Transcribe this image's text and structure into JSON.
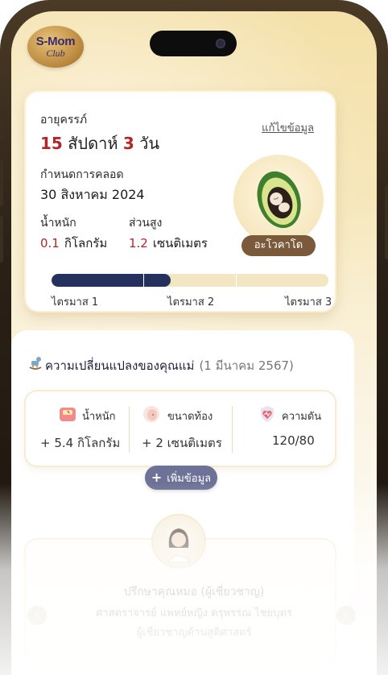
{
  "logo": {
    "line1": "S-Mom",
    "line2": "Club"
  },
  "pregnancy": {
    "age_label": "อายุครรภ์",
    "edit_link": "แก้ไขข้อมูล",
    "weeks": "15",
    "weeks_unit": "สัปดาห์",
    "days": "3",
    "days_unit": "วัน",
    "due_label": "กำหนดการคลอด",
    "due_date": "30 สิงหาคม 2024",
    "weight_label": "น้ำหนัก",
    "weight_value": "0.1",
    "weight_unit": "กิโลกรัม",
    "height_label": "ส่วนสูง",
    "height_value": "1.2",
    "height_unit": "เซนติเมตร",
    "fruit_name": "อะโวคาโด",
    "trimester_progress": 0.43,
    "trimesters": [
      "ไตรมาส 1",
      "ไตรมาส 2",
      "ไตรมาส 3"
    ]
  },
  "changes": {
    "title": "ความเปลี่ยนแปลงของคุณแม่",
    "date": "(1 มีนาคม 2567)",
    "stats": [
      {
        "icon": "scale-icon",
        "label": "น้ำหนัก",
        "value": "+ 5.4 กิโลกรัม"
      },
      {
        "icon": "belly-icon",
        "label": "ขนาดท้อง",
        "value": "+ 2 เซนติเมตร"
      },
      {
        "icon": "heart-shield-icon",
        "label": "ความดัน",
        "value": "120/80"
      }
    ],
    "add_button": "เพิ่มข้อมูล"
  },
  "doctor": {
    "role": "ปรึกษาคุณหมอ (ผู้เชี่ยวชาญ)",
    "name": "ศาสตราจารย์ แพทย์หญิง ดรุพรรณ ไชยบุตร",
    "extra": "ผู้เชี่ยวชาญด้านสูติศาสตร์"
  },
  "colors": {
    "accent_red": "#b2262a",
    "progress": "#24305e",
    "fruit_tag": "#7b5a3c",
    "add_button": "#6e7296"
  }
}
